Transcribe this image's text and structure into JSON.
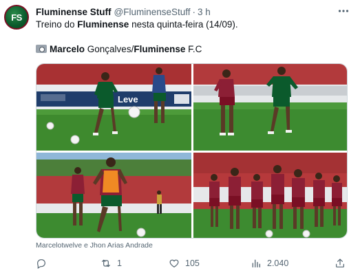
{
  "author": {
    "name": "Fluminense Stuff",
    "handle": "@FluminenseStuff",
    "separator": "·",
    "time": "3 h",
    "avatar_text": "FS"
  },
  "tweet": {
    "line1_prefix": "Treino do ",
    "line1_bold": "Fluminense",
    "line1_suffix": " nesta quinta-feira (14/09).",
    "line2_credit_name": "Marcelo",
    "line2_credit_rest": " Gonçalves/",
    "line2_credit_org": "Fluminense",
    "line2_credit_end": " F.C"
  },
  "media": {
    "photos": [
      {
        "id": "photo-1",
        "board_text": "Leve"
      },
      {
        "id": "photo-2"
      },
      {
        "id": "photo-3"
      },
      {
        "id": "photo-4"
      }
    ],
    "caption": "Marcelotwelve e Jhon Arias Andrade"
  },
  "actions": {
    "reply_count": "",
    "retweet_count": "1",
    "like_count": "105",
    "views_count": "2.040"
  },
  "colors": {
    "text_primary": "#0f1419",
    "text_secondary": "#536471",
    "border": "#cfd9de",
    "grass": "#3e8a2e",
    "wall_red": "#b8383a",
    "fluminense_green": "#0b5a2c",
    "fluminense_garnet": "#7a0f24"
  }
}
